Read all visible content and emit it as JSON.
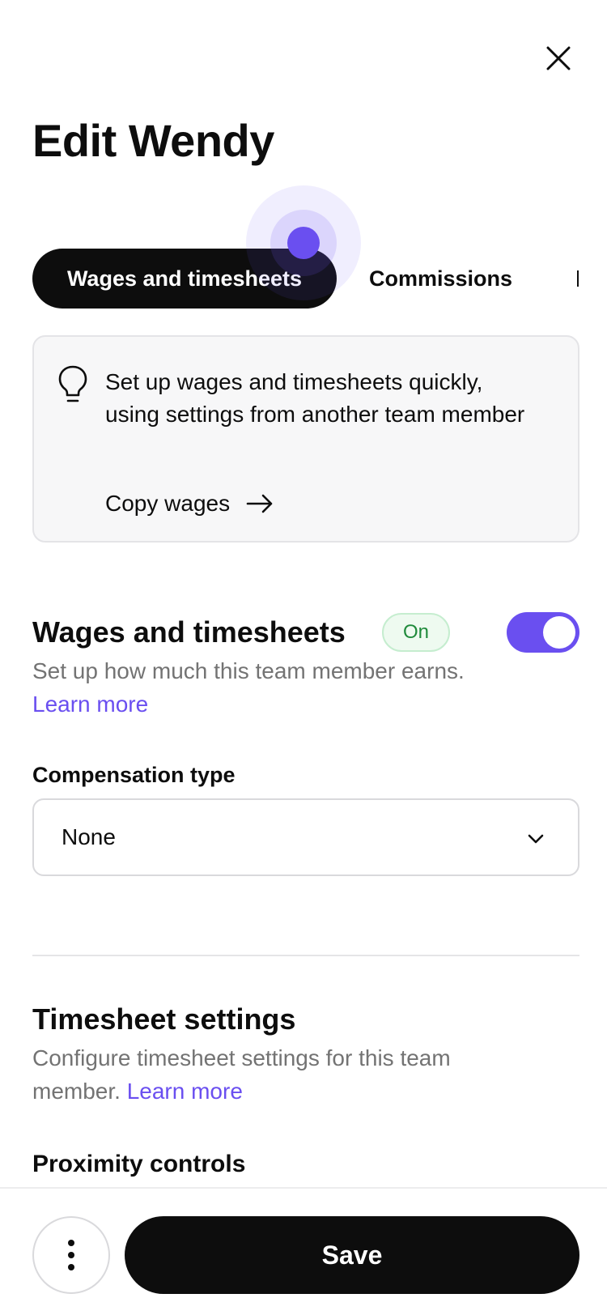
{
  "header": {
    "title": "Edit Wendy",
    "close_icon": "close-icon"
  },
  "tabs": {
    "items": [
      {
        "label": "Wages and timesheets",
        "active": true
      },
      {
        "label": "Commissions",
        "active": false
      }
    ]
  },
  "info_card": {
    "icon": "lightbulb-icon",
    "text": "Set up wages and timesheets quickly, using settings from another team member",
    "link_label": "Copy wages",
    "link_icon": "arrow-right-icon"
  },
  "wages_section": {
    "title": "Wages and timesheets",
    "badge": "On",
    "toggle_on": true,
    "description": "Set up how much this team member earns.",
    "learn_more": "Learn more",
    "field_label": "Compensation type",
    "select_value": "None",
    "select_icon": "chevron-down-icon"
  },
  "timesheet_section": {
    "title": "Timesheet settings",
    "description": "Configure timesheet settings for this team member.",
    "learn_more": "Learn more",
    "subheading": "Proximity controls"
  },
  "footer": {
    "more_icon": "more-vertical-icon",
    "save_label": "Save"
  },
  "colors": {
    "accent": "#6a4ff0",
    "primary": "#0d0d0d",
    "badge_text": "#1f8a3b",
    "badge_bg": "#eefaf0",
    "muted_text": "#737373"
  }
}
